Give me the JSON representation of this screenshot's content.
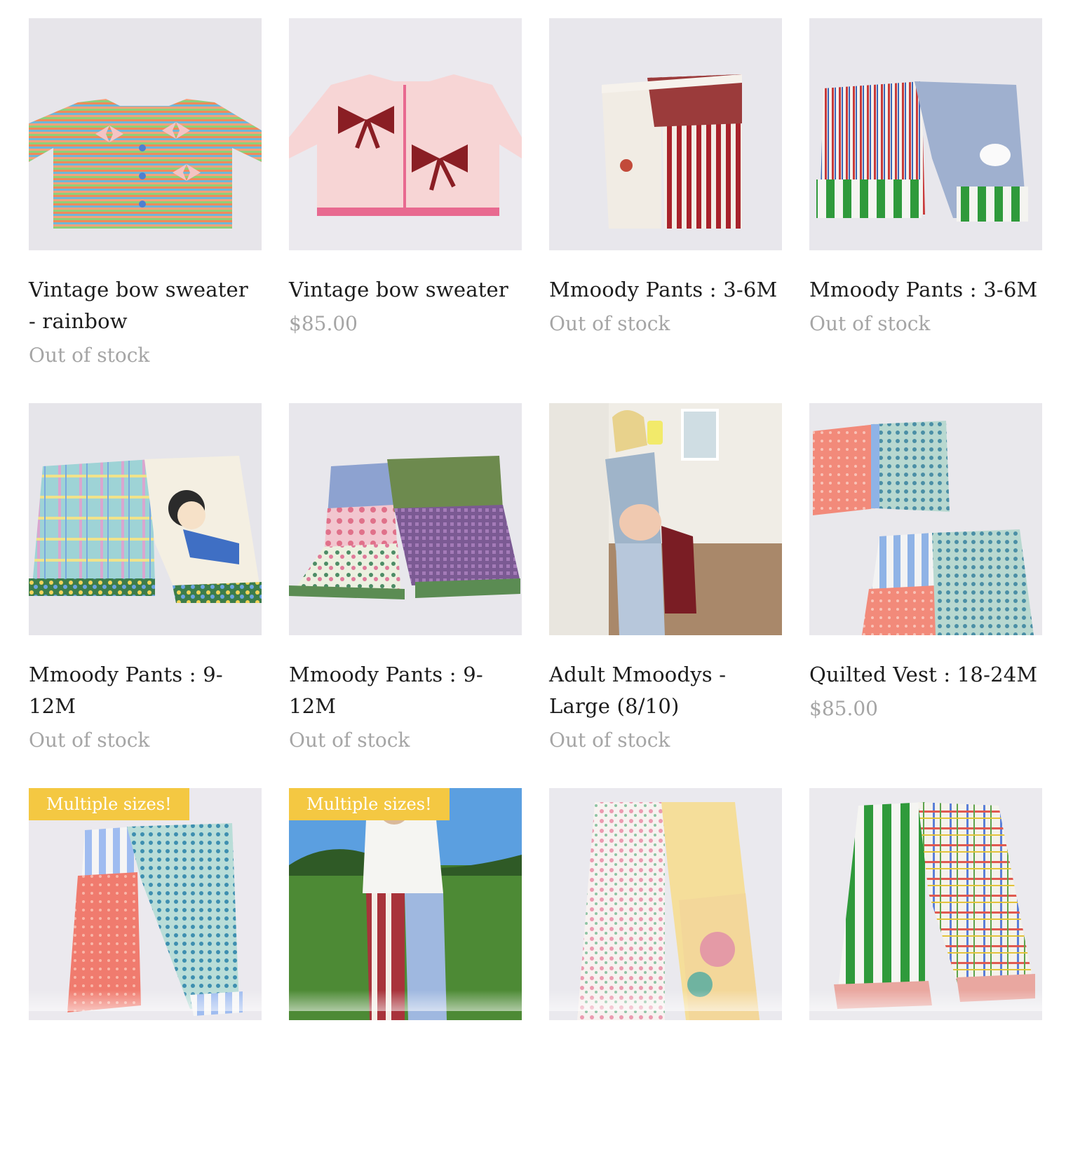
{
  "products": [
    {
      "title": "Vintage bow sweater - rainbow",
      "price": "Out of stock",
      "image": "rainbow-knit-sweater-with-pink-bows",
      "badge": ""
    },
    {
      "title": "Vintage bow sweater",
      "price": "$85.00",
      "image": "pink-knit-sweater-with-red-bows",
      "badge": ""
    },
    {
      "title": "Mmoody Pants : 3-6M",
      "price": "Out of stock",
      "image": "patchwork-pants-red-stripe",
      "badge": ""
    },
    {
      "title": "Mmoody Pants : 3-6M",
      "price": "Out of stock",
      "image": "patchwork-pants-green-stripe-cuffs",
      "badge": ""
    },
    {
      "title": "Mmoody Pants : 9-12M",
      "price": "Out of stock",
      "image": "plaid-cartoon-patchwork-pants",
      "badge": ""
    },
    {
      "title": "Mmoody Pants : 9-12M",
      "price": "Out of stock",
      "image": "floral-gingham-patchwork-pants",
      "badge": ""
    },
    {
      "title": "Adult Mmoodys - Large (8/10)",
      "price": "Out of stock",
      "image": "mirror-selfie-pregnant-model",
      "badge": ""
    },
    {
      "title": "Quilted Vest : 18-24M",
      "price": "$85.00",
      "image": "quilted-vest-and-pants-set",
      "badge": ""
    },
    {
      "title": "",
      "price": "",
      "image": "coral-blue-floral-pants",
      "badge": "Multiple sizes!"
    },
    {
      "title": "",
      "price": "",
      "image": "child-in-patchwork-pants-outdoors",
      "badge": "Multiple sizes!"
    },
    {
      "title": "",
      "price": "",
      "image": "floral-yellow-adult-pants",
      "badge": ""
    },
    {
      "title": "",
      "price": "",
      "image": "green-stripe-plaid-pants",
      "badge": ""
    }
  ],
  "colors": {
    "badge_bg": "#f4c842",
    "title": "#1c1c1c",
    "price": "#a5a5a5"
  }
}
